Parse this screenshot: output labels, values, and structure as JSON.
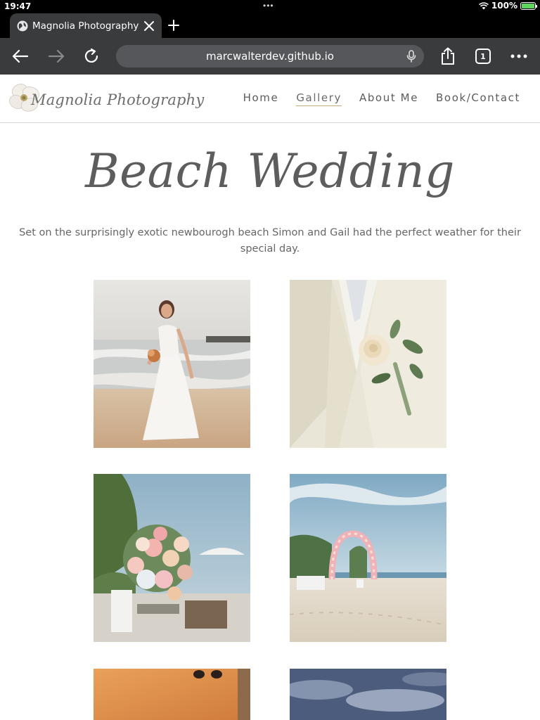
{
  "status_bar": {
    "time": "19:47",
    "battery": "100%",
    "battery_level": 1.0
  },
  "browser": {
    "tab_title": "Magnolia Photography | …",
    "url": "marcwalterdev.github.io",
    "tab_count": "1",
    "icons": [
      "globe-icon",
      "close-icon",
      "plus-icon",
      "back-icon",
      "forward-icon",
      "reload-icon",
      "microphone-icon",
      "share-icon",
      "tabs-icon",
      "more-icon"
    ]
  },
  "site": {
    "logo_text": "Magnolia Photography",
    "nav": [
      {
        "label": "Home",
        "active": false
      },
      {
        "label": "Gallery",
        "active": true
      },
      {
        "label": "About Me",
        "active": false
      },
      {
        "label": "Book/Contact",
        "active": false
      }
    ]
  },
  "page": {
    "title": "Beach Wedding",
    "description": "Set on the surprisingly exotic newbourogh beach Simon and Gail had the perfect weather for their special day."
  },
  "gallery": [
    {
      "subject": "bride-on-beach"
    },
    {
      "subject": "groom-boutonniere"
    },
    {
      "subject": "floral-centerpiece"
    },
    {
      "subject": "beach-ceremony-arch"
    },
    {
      "subject": "sunset-sky"
    },
    {
      "subject": "cloudy-sky"
    }
  ],
  "colors": {
    "accent_underline": "#c8a97a",
    "browser_chrome": "#3a3b3d",
    "text_gray": "#5b5b5b"
  }
}
